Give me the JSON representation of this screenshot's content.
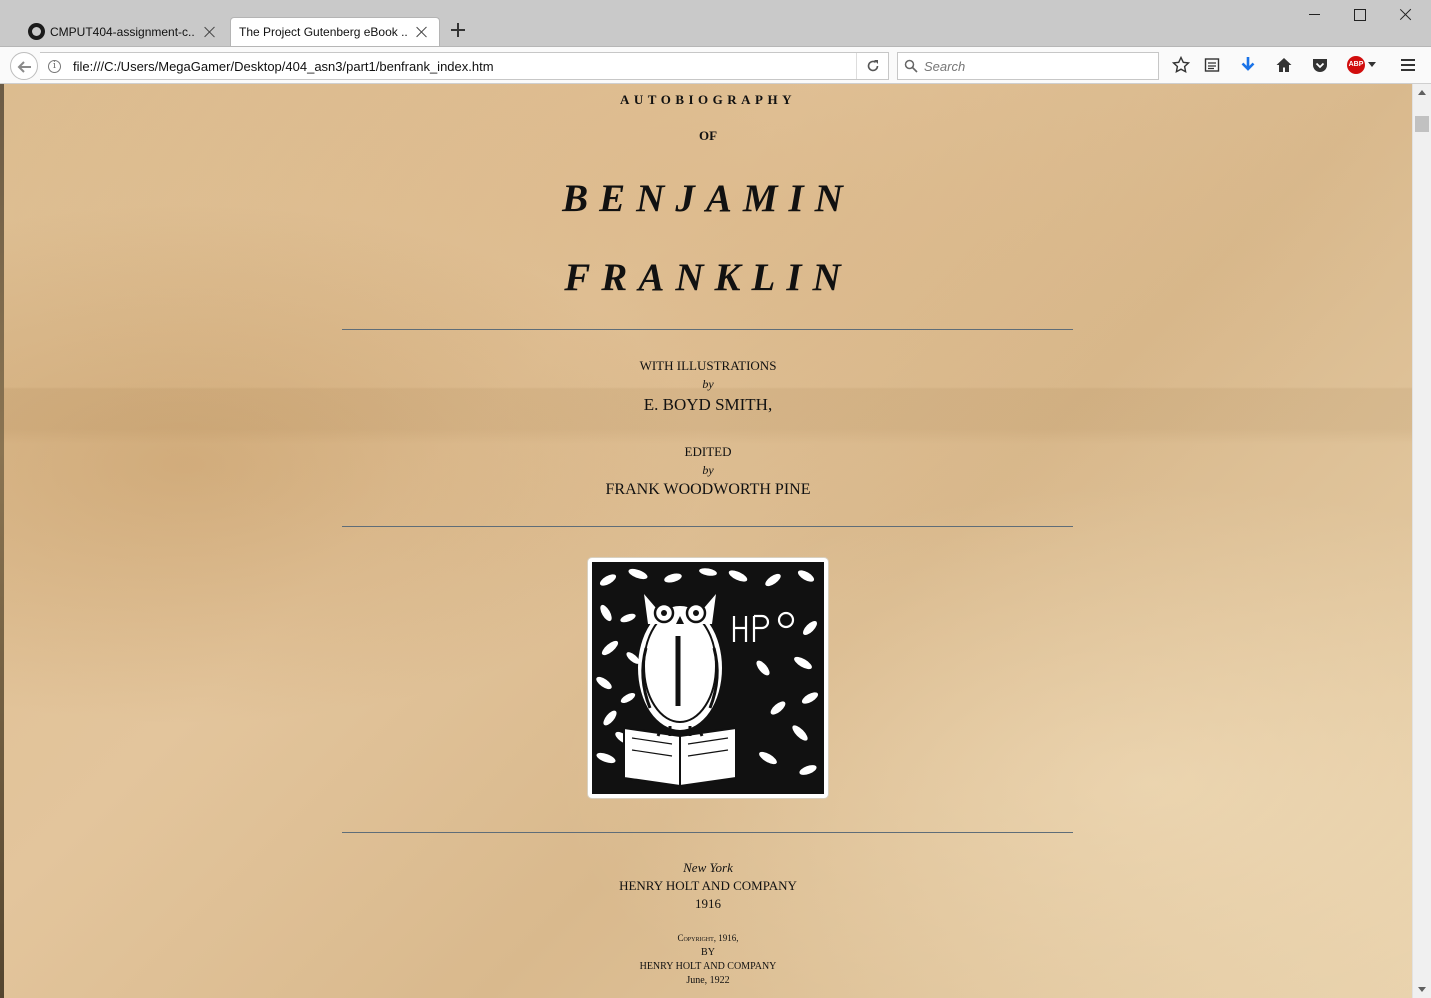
{
  "browser": {
    "tabs": [
      {
        "label": "CMPUT404-assignment-c...",
        "active": false,
        "icon": "github-icon"
      },
      {
        "label": "The Project Gutenberg eBook ...",
        "active": true
      }
    ],
    "url": "file:///C:/Users/MegaGamer/Desktop/404_asn3/part1/benfrank_index.htm",
    "search_placeholder": "Search",
    "toolbar_icons": [
      "bookmark-star-icon",
      "reading-list-icon",
      "download-icon",
      "home-icon",
      "pocket-icon",
      "adblock-plus-icon",
      "menu-icon"
    ],
    "abp_label": "ABP",
    "accent_colors": {
      "download": "#1a73e8",
      "adblock": "#d10d0d"
    }
  },
  "page": {
    "heading_small": "AUTOBIOGRAPHY",
    "heading_of": "OF",
    "name_first": "BENJAMIN",
    "name_last": "FRANKLIN",
    "illustrations_label": "WITH ILLUSTRATIONS",
    "by_1": "by",
    "illustrator": "E. BOYD SMITH,",
    "edited_label": "EDITED",
    "by_2": "by",
    "editor": "FRANK WOODWORTH PINE",
    "place": "New York",
    "publisher": "HENRY HOLT AND COMPANY",
    "year": "1916",
    "copyright_line": "Copyright, 1916,",
    "copyright_by": "BY",
    "copyright_publisher": "HENRY HOLT AND COMPANY",
    "copyright_date": "June, 1922",
    "colophon_icon": "owl-colophon-icon"
  }
}
